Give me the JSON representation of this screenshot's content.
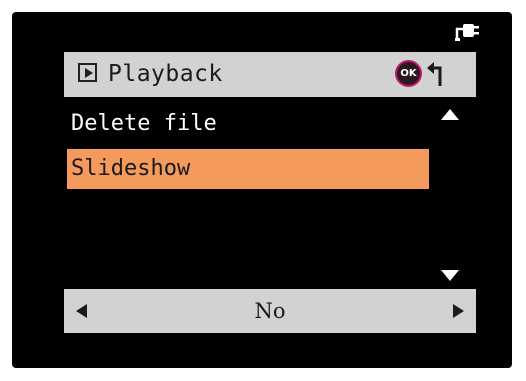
{
  "header": {
    "mode_icon": "playback-icon",
    "title": "Playback",
    "ok_label": "OK",
    "back_icon": "back-arrow-icon"
  },
  "status": {
    "power_icon": "power-plug-icon"
  },
  "menu": {
    "items": [
      {
        "label": "Delete file",
        "selected": false
      },
      {
        "label": "Slideshow",
        "selected": true
      }
    ],
    "scroll_up_icon": "scroll-up-arrow-icon",
    "scroll_down_icon": "scroll-down-arrow-icon"
  },
  "value_selector": {
    "value": "No",
    "prev_icon": "left-arrow-icon",
    "next_icon": "right-arrow-icon"
  },
  "colors": {
    "background": "#000000",
    "bar": "#d2d2d2",
    "highlight": "#f39a5c",
    "ok_ring": "#c21770"
  }
}
